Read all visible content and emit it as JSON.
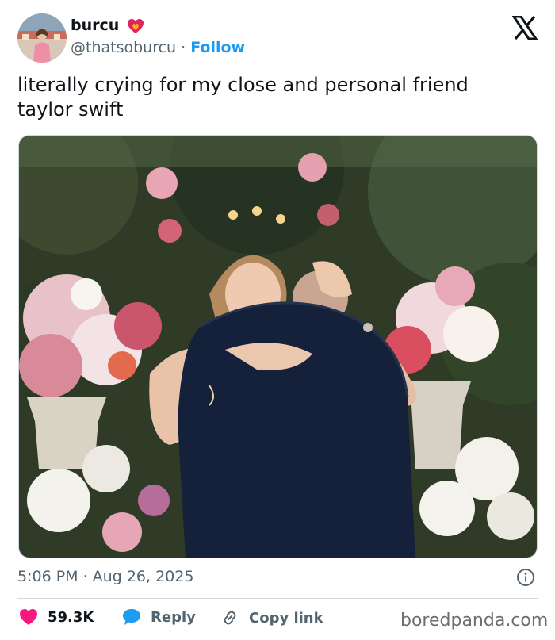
{
  "author": {
    "name": "burcu",
    "handle": "@thatsoburcu",
    "separator": " · ",
    "follow_label": "Follow"
  },
  "tweet": {
    "text_line1": "literally crying for my close and personal friend",
    "text_line2": "taylor swift",
    "image_icon": "photo-image",
    "timestamp": "5:06 PM · Aug 26, 2025"
  },
  "actions": {
    "likes": "59.3K",
    "reply_label": "Reply",
    "copy_link_label": "Copy link"
  },
  "icons": {
    "brand": "x-logo-icon",
    "badge": "heart-badge-icon",
    "info": "info-icon",
    "like": "heart-icon",
    "reply": "reply-bubble-icon",
    "copy": "link-icon"
  },
  "watermark": "boredpanda.com",
  "colors": {
    "accent": "#1d9bf0",
    "like": "#f91880",
    "text": "#0f1419",
    "secondary": "#536471",
    "border": "#cfd9de"
  }
}
